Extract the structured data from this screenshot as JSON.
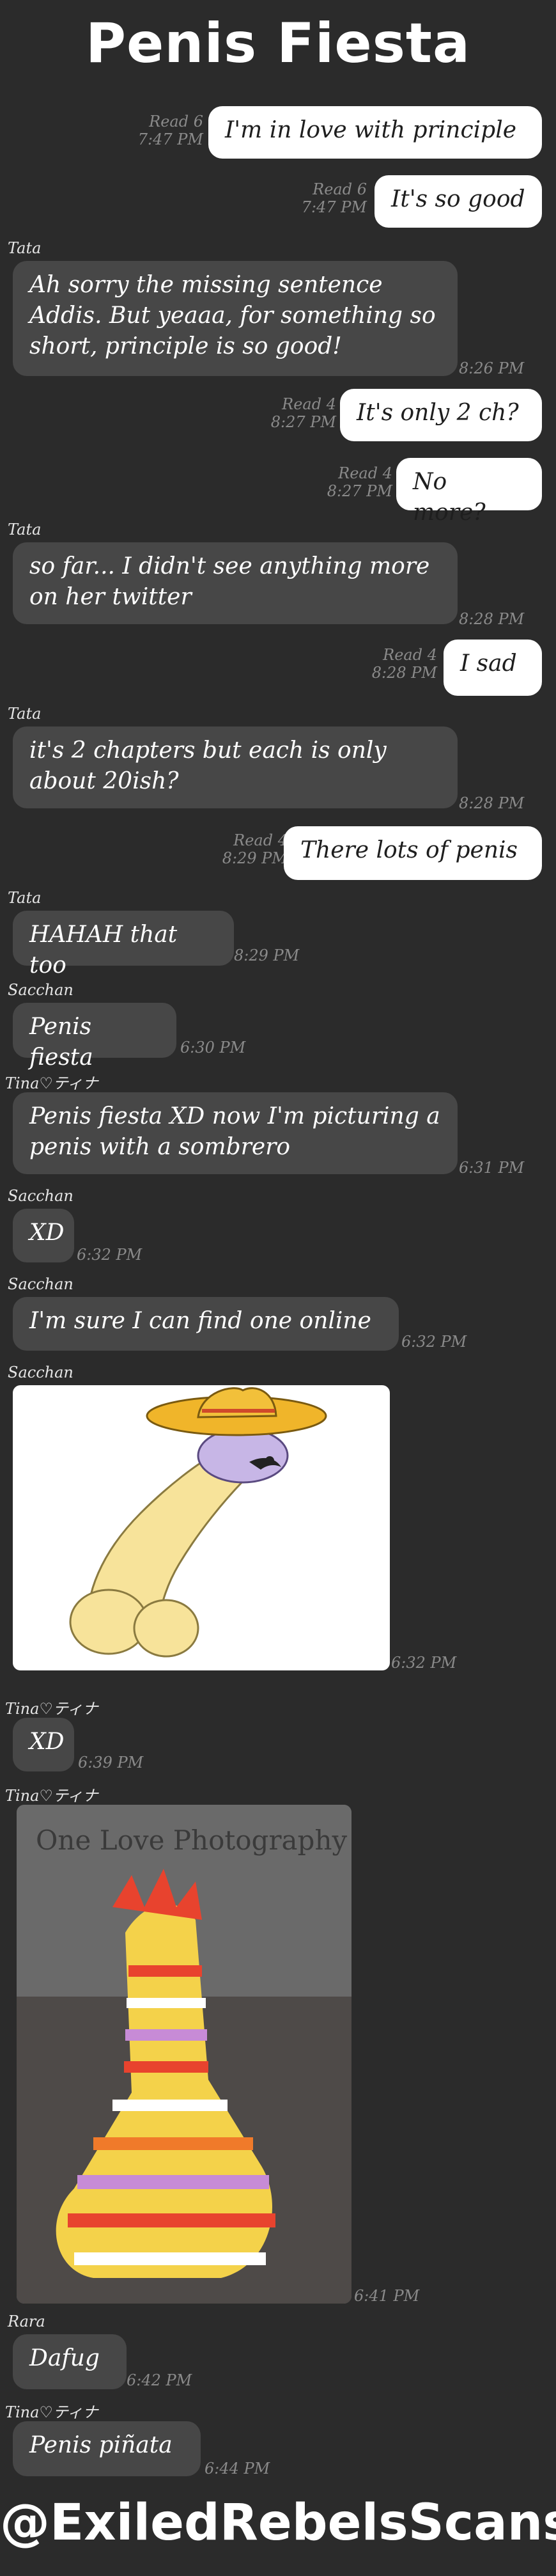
{
  "header": {
    "title": "Penis Fiesta"
  },
  "messages": [
    {
      "dir": "out",
      "text": "I'm in love with principle",
      "read": "Read 6",
      "time": "7:47 PM"
    },
    {
      "dir": "out",
      "text": "It's so good",
      "read": "Read 6",
      "time": "7:47 PM"
    },
    {
      "dir": "in",
      "sender": "Tata",
      "text": "Ah sorry the missing sentence Addis. But yeaaa, for something so short, principle is so good!",
      "time": "8:26 PM"
    },
    {
      "dir": "out",
      "text": "It's only 2 ch?",
      "read": "Read 4",
      "time": "8:27 PM"
    },
    {
      "dir": "out",
      "text": "No more?",
      "read": "Read 4",
      "time": "8:27 PM"
    },
    {
      "dir": "in",
      "sender": "Tata",
      "text": "so far... I didn't see anything more on her twitter",
      "time": "8:28 PM"
    },
    {
      "dir": "out",
      "text": "I sad",
      "read": "Read 4",
      "time": "8:28 PM"
    },
    {
      "dir": "in",
      "sender": "Tata",
      "text": "it's 2 chapters but each is only about 20ish?",
      "time": "8:28 PM"
    },
    {
      "dir": "out",
      "text": "There lots of penis",
      "read": "Read 4",
      "time": "8:29 PM"
    },
    {
      "dir": "in",
      "sender": "Tata",
      "text": "HAHAH that too",
      "time": "8:29 PM"
    },
    {
      "dir": "in",
      "sender": "Sacchan",
      "text": "Penis fiesta",
      "time": "6:30 PM"
    },
    {
      "dir": "in",
      "sender": "Tina♡ティナ",
      "text": "Penis fiesta XD now I'm picturing a penis with a sombrero",
      "time": "6:31 PM"
    },
    {
      "dir": "in",
      "sender": "Sacchan",
      "text": "XD",
      "time": "6:32 PM"
    },
    {
      "dir": "in",
      "sender": "Sacchan",
      "text": "I'm sure I can find one online",
      "time": "6:32 PM"
    },
    {
      "dir": "in",
      "sender": "Sacchan",
      "image": "sombrero-cartoon-image",
      "time": "6:32 PM"
    },
    {
      "dir": "in",
      "sender": "Tina♡ティナ",
      "text": "XD",
      "time": "6:39 PM"
    },
    {
      "dir": "in",
      "sender": "Tina♡ティナ",
      "image": "pinata-photo",
      "photo_watermark": "One Love Photography",
      "time": "6:41 PM"
    },
    {
      "dir": "in",
      "sender": "Rara",
      "text": "Dafug",
      "time": "6:42 PM"
    },
    {
      "dir": "in",
      "sender": "Tina♡ティナ",
      "text": "Penis piñata",
      "time": "6:44 PM"
    }
  ],
  "footer": {
    "credit": "@ExiledRebelsScans"
  },
  "colors": {
    "background": "#2b2b2b",
    "incoming_bubble": "#474747",
    "outgoing_bubble": "#ffffff",
    "meta_text": "#8a8a8a"
  }
}
